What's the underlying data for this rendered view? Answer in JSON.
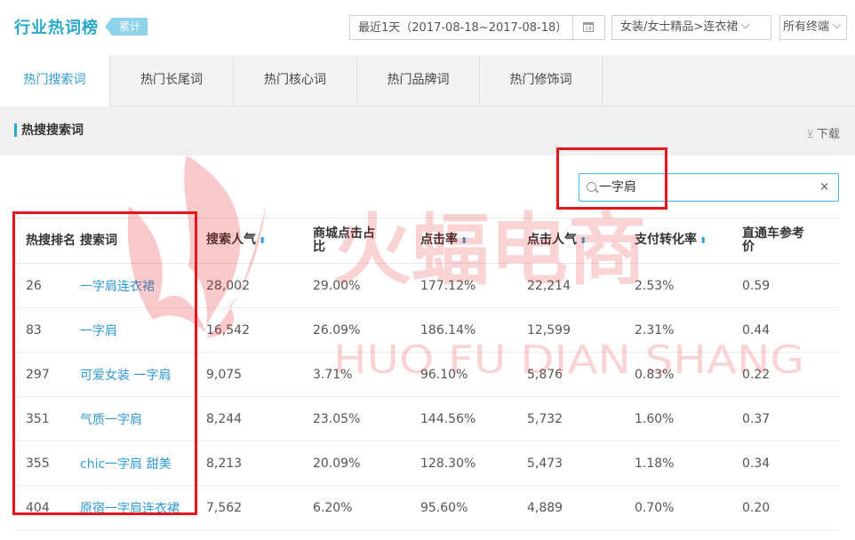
{
  "header": {
    "title": "行业热词榜",
    "badge": "累计",
    "date_range": "最近1天（2017-08-18~2017-08-18）",
    "calendar_day": "18",
    "category": "女装/女士精品>连衣裙",
    "terminal": "所有终端"
  },
  "tabs": [
    {
      "label": "热门搜索词"
    },
    {
      "label": "热门长尾词"
    },
    {
      "label": "热门核心词"
    },
    {
      "label": "热门品牌词"
    },
    {
      "label": "热门修饰词"
    }
  ],
  "section": {
    "title": "热搜搜索词",
    "download": "下载"
  },
  "search": {
    "value": "一字肩",
    "clear": "×"
  },
  "table": {
    "headers": [
      "热搜排名",
      "搜索词",
      "搜索人气",
      "商城点击占比",
      "点击率",
      "点击人气",
      "支付转化率",
      "直通车参考价"
    ],
    "rows": [
      [
        "26",
        "一字肩连衣裙",
        "28,002",
        "29.00%",
        "177.12%",
        "22,214",
        "2.53%",
        "0.59"
      ],
      [
        "83",
        "一字肩",
        "16,542",
        "26.09%",
        "186.14%",
        "12,599",
        "2.31%",
        "0.44"
      ],
      [
        "297",
        "可爱女装 一字肩",
        "9,075",
        "3.71%",
        "96.10%",
        "5,876",
        "0.83%",
        "0.22"
      ],
      [
        "351",
        "气质一字肩",
        "8,244",
        "23.05%",
        "144.56%",
        "5,732",
        "1.60%",
        "0.37"
      ],
      [
        "355",
        "chic一字肩 甜美",
        "8,213",
        "20.09%",
        "128.30%",
        "5,473",
        "1.18%",
        "0.34"
      ],
      [
        "404",
        "原宿一字肩连衣裙",
        "7,562",
        "6.20%",
        "95.60%",
        "4,889",
        "0.70%",
        "0.20"
      ]
    ]
  },
  "watermark": {
    "main": "火蝠电商",
    "sub": "HUO FU DIAN SHANG",
    "color": "#e8141d"
  },
  "colors": {
    "accent": "#2aa7c9",
    "link": "#2f9ad4",
    "highlight": "#e8141d"
  }
}
